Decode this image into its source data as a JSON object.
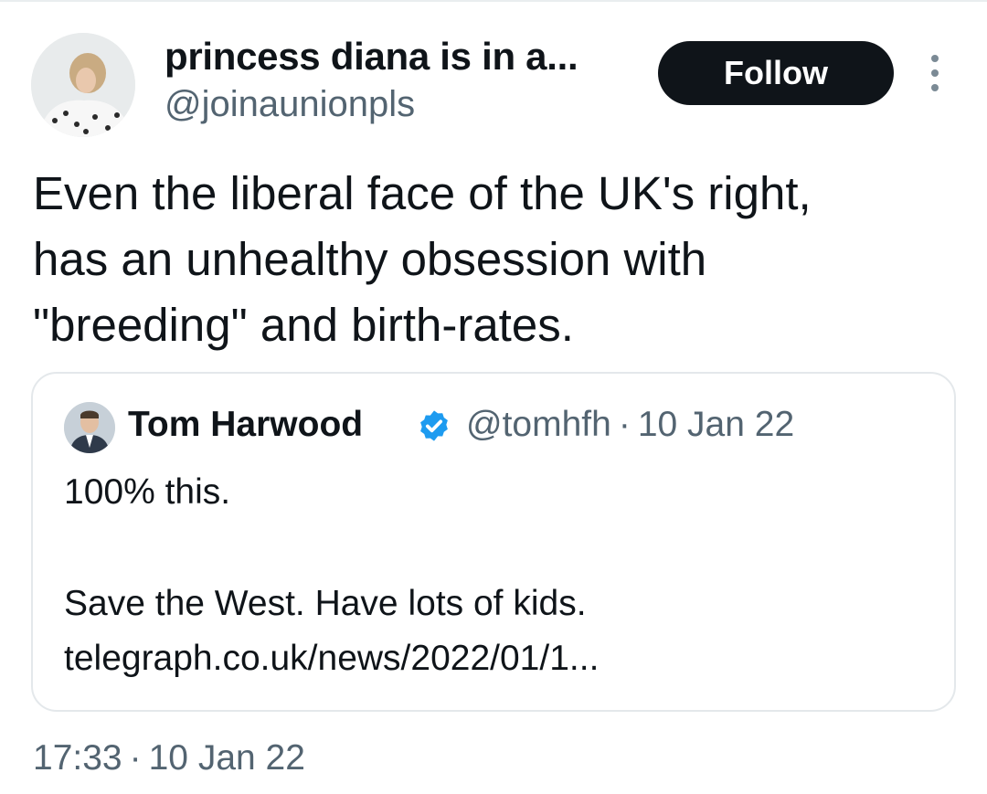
{
  "author": {
    "name": "princess diana is in a...",
    "handle": "@joinaunionpls"
  },
  "follow_label": "Follow",
  "more_icon": "more-vertical-icon",
  "tweet": {
    "text": "Even the liberal face of the UK's right,\nhas an unhealthy obsession with\n\"breeding\" and birth-rates."
  },
  "quoted": {
    "name": "Tom Harwood",
    "verified_icon": "verified-badge-icon",
    "handle": "@tomhfh",
    "separator": "·",
    "date": "10 Jan 22",
    "line1": "100% this.",
    "line2": "Save the West. Have lots of kids.",
    "link": "telegraph.co.uk/news/2022/01/1..."
  },
  "timestamp": {
    "time": "17:33",
    "separator": "·",
    "date": "10 Jan 22"
  },
  "colors": {
    "text": "#0f1419",
    "secondary": "#536471",
    "verified": "#1d9bf0",
    "button": "#0f1419",
    "border": "#e4e8eb"
  }
}
